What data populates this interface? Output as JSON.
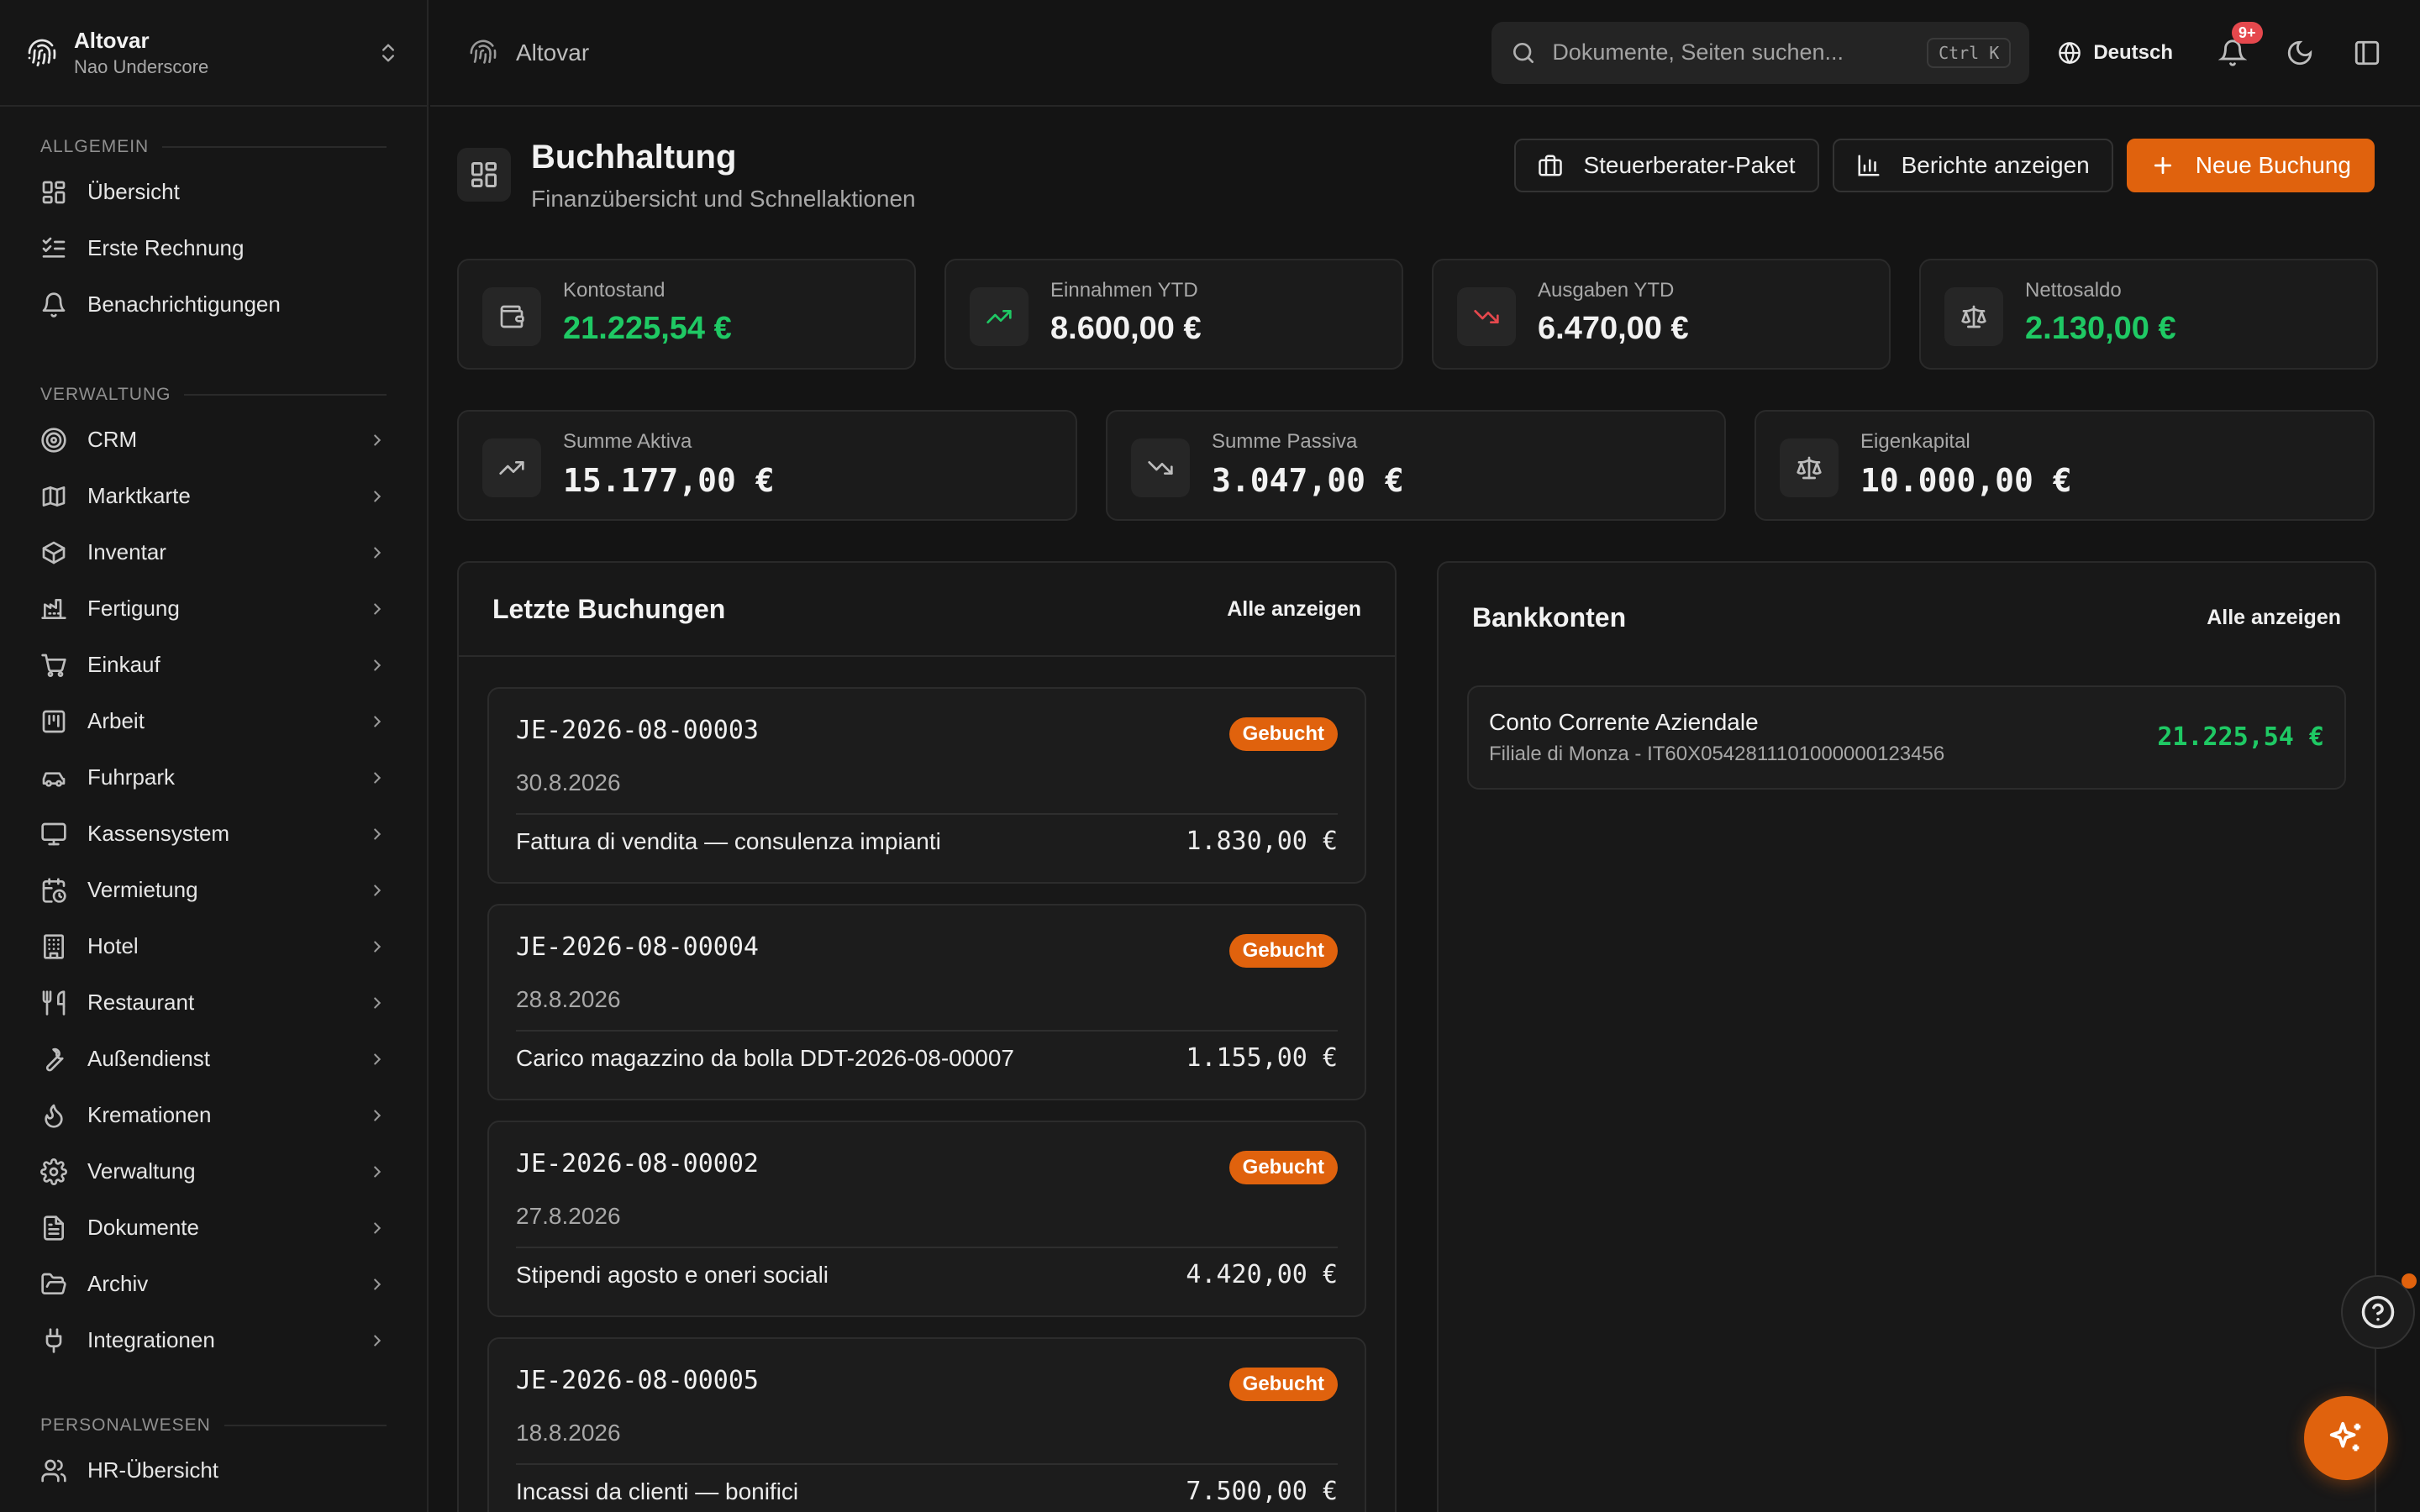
{
  "app": {
    "name": "Altovar",
    "user": "Nao Underscore"
  },
  "sidebar": {
    "sections": [
      {
        "label": "Allgemein",
        "items": [
          {
            "label": "Übersicht",
            "icon": "dashboard-icon",
            "chevron": false
          },
          {
            "label": "Erste Rechnung",
            "icon": "checklist-icon",
            "chevron": false
          },
          {
            "label": "Benachrichtigungen",
            "icon": "bell-icon",
            "chevron": false
          }
        ]
      },
      {
        "label": "Verwaltung",
        "items": [
          {
            "label": "CRM",
            "icon": "target-icon",
            "chevron": true
          },
          {
            "label": "Marktkarte",
            "icon": "map-icon",
            "chevron": true
          },
          {
            "label": "Inventar",
            "icon": "box-icon",
            "chevron": true
          },
          {
            "label": "Fertigung",
            "icon": "factory-icon",
            "chevron": true
          },
          {
            "label": "Einkauf",
            "icon": "cart-icon",
            "chevron": true
          },
          {
            "label": "Arbeit",
            "icon": "timesheet-icon",
            "chevron": true
          },
          {
            "label": "Fuhrpark",
            "icon": "car-icon",
            "chevron": true
          },
          {
            "label": "Kassensystem",
            "icon": "monitor-icon",
            "chevron": true
          },
          {
            "label": "Vermietung",
            "icon": "calendar-clock-icon",
            "chevron": true
          },
          {
            "label": "Hotel",
            "icon": "building-icon",
            "chevron": true
          },
          {
            "label": "Restaurant",
            "icon": "utensils-icon",
            "chevron": true
          },
          {
            "label": "Außendienst",
            "icon": "wrench-icon",
            "chevron": true
          },
          {
            "label": "Kremationen",
            "icon": "flame-icon",
            "chevron": true
          },
          {
            "label": "Verwaltung",
            "icon": "gear-icon",
            "chevron": true
          },
          {
            "label": "Dokumente",
            "icon": "file-icon",
            "chevron": true
          },
          {
            "label": "Archiv",
            "icon": "folder-open-icon",
            "chevron": true
          },
          {
            "label": "Integrationen",
            "icon": "plug-icon",
            "chevron": true
          }
        ]
      },
      {
        "label": "Personalwesen",
        "items": [
          {
            "label": "HR-Übersicht",
            "icon": "users-icon",
            "chevron": false
          }
        ]
      }
    ]
  },
  "topbar": {
    "breadcrumb": "Altovar",
    "search_placeholder": "Dokumente, Seiten suchen...",
    "search_shortcut": "Ctrl K",
    "language": "Deutsch",
    "notification_badge": "9+"
  },
  "header": {
    "title": "Buchhaltung",
    "subtitle": "Finanzübersicht und Schnellaktionen",
    "actions": {
      "tax_package": "Steuerberater-Paket",
      "reports": "Berichte anzeigen",
      "new_entry": "Neue Buchung"
    }
  },
  "kpis": [
    {
      "label": "Kontostand",
      "value": "21.225,54 €",
      "color": "#1fc964",
      "icon": "wallet-icon"
    },
    {
      "label": "Einnahmen YTD",
      "value": "8.600,00 €",
      "color": "#f2f2f2",
      "icon": "trending-up-icon"
    },
    {
      "label": "Ausgaben YTD",
      "value": "6.470,00 €",
      "color": "#f2f2f2",
      "icon": "trending-down-icon"
    },
    {
      "label": "Nettosaldo",
      "value": "2.130,00 €",
      "color": "#1fc964",
      "icon": "scale-icon"
    }
  ],
  "balance": [
    {
      "label": "Summe Aktiva",
      "value": "15.177,00 €",
      "icon": "trending-up-icon"
    },
    {
      "label": "Summe Passiva",
      "value": "3.047,00 €",
      "icon": "trending-down-icon"
    },
    {
      "label": "Eigenkapital",
      "value": "10.000,00 €",
      "icon": "scale-icon"
    }
  ],
  "journal": {
    "title": "Letzte Buchungen",
    "view_all": "Alle anzeigen",
    "entries": [
      {
        "id": "JE-2026-08-00003",
        "status": "Gebucht",
        "date": "30.8.2026",
        "description": "Fattura di vendita — consulenza impianti",
        "amount": "1.830,00 €"
      },
      {
        "id": "JE-2026-08-00004",
        "status": "Gebucht",
        "date": "28.8.2026",
        "description": "Carico magazzino da bolla DDT-2026-08-00007",
        "amount": "1.155,00 €"
      },
      {
        "id": "JE-2026-08-00002",
        "status": "Gebucht",
        "date": "27.8.2026",
        "description": "Stipendi agosto e oneri sociali",
        "amount": "4.420,00 €"
      },
      {
        "id": "JE-2026-08-00005",
        "status": "Gebucht",
        "date": "18.8.2026",
        "description": "Incassi da clienti — bonifici",
        "amount": "7.500,00 €"
      }
    ]
  },
  "bank": {
    "title": "Bankkonten",
    "view_all": "Alle anzeigen",
    "accounts": [
      {
        "name": "Conto Corrente Aziendale",
        "details": "Filiale di Monza - IT60X0542811101000000123456",
        "balance": "21.225,54 €"
      }
    ]
  },
  "colors": {
    "accent": "#e0620d",
    "positive": "#1fc964",
    "negative": "#e5484d"
  }
}
